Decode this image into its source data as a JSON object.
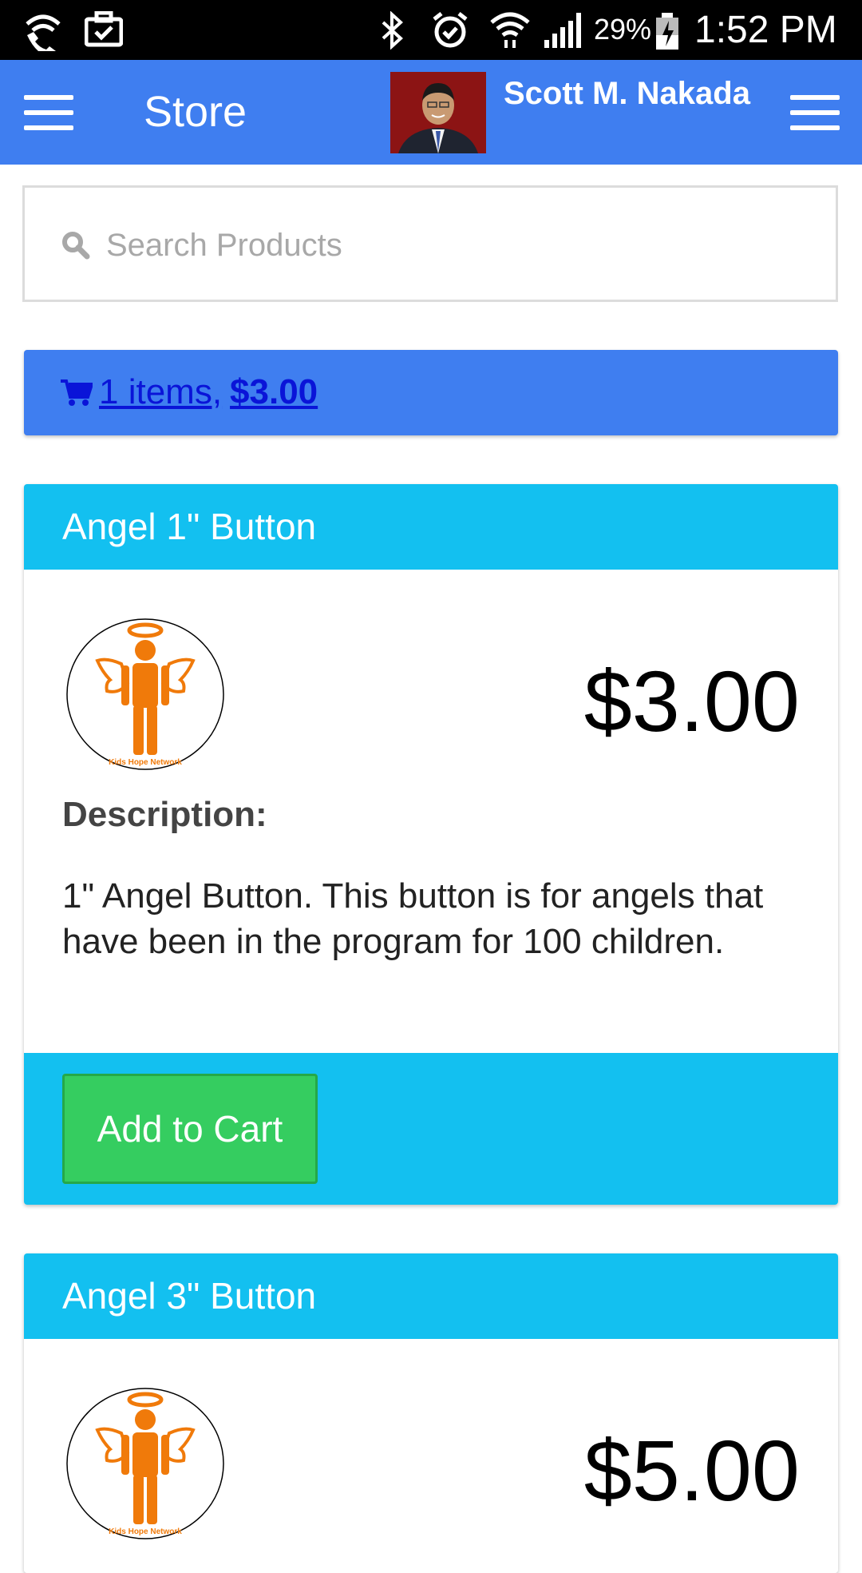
{
  "status_bar": {
    "battery": "29%",
    "time": "1:52 PM",
    "icons": [
      "wifi-calling-icon",
      "briefcase-icon",
      "bluetooth-icon",
      "alarm-icon",
      "wifi-icon",
      "signal-icon",
      "battery-charging-icon"
    ]
  },
  "app_bar": {
    "title": "Store",
    "user_name": "Scott M. Nakada",
    "bg_color": "#3f7ef0"
  },
  "search": {
    "placeholder": "Search Products",
    "value": ""
  },
  "cart": {
    "count_text": "1 items,",
    "total": "$3.00"
  },
  "products": [
    {
      "name": "Angel 1\" Button",
      "price": "$3.00",
      "description_label": "Description:",
      "description": "1\" Angel Button. This button is for angels that have been in the program for 100 children.",
      "image_caption": "Kids Hope Network",
      "add_label": "Add to Cart"
    },
    {
      "name": "Angel 3\" Button",
      "price": "$5.00",
      "image_caption": "Kids Hope Network"
    }
  ],
  "colors": {
    "accent": "#3f7ef0",
    "card_header": "#13c0f0",
    "add_button": "#35cd60",
    "angel_orange": "#f07a0a"
  }
}
